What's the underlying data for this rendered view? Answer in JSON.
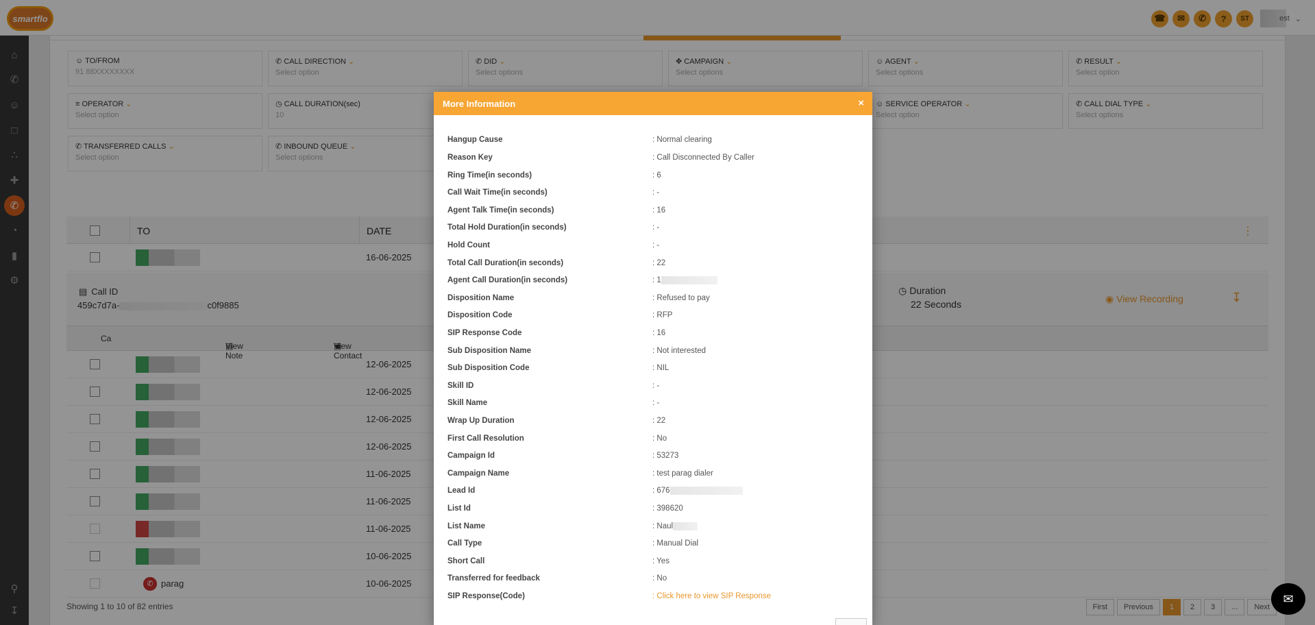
{
  "app": {
    "logo_text": "smartflo"
  },
  "topbar": {
    "icons": [
      "phone-icon",
      "chat-icon",
      "call-icon",
      "help-icon"
    ],
    "avatar_initials": "ST",
    "user_suffix": "est"
  },
  "sidebar": {
    "items": [
      "home-icon",
      "phone-icon",
      "users-icon",
      "monitor-icon",
      "network-icon",
      "plug-icon",
      "call-log-icon",
      "pie-chart-icon",
      "bar-chart-icon",
      "settings-icon",
      "search-icon",
      "download-icon"
    ]
  },
  "filters": [
    {
      "label": "TO/FROM",
      "value": "91 88XXXXXXXX",
      "icon": "person-icon"
    },
    {
      "label": "CALL DIRECTION",
      "value": "Select option",
      "icon": "phone-icon"
    },
    {
      "label": "DID",
      "value": "Select options",
      "icon": "phone-icon"
    },
    {
      "label": "CAMPAIGN",
      "value": "Select options",
      "icon": "campaign-icon"
    },
    {
      "label": "AGENT",
      "value": "Select options",
      "icon": "agent-icon"
    },
    {
      "label": "RESULT",
      "value": "Select option",
      "icon": "result-icon"
    },
    {
      "label": "OPERATOR",
      "value": "Select option",
      "icon": "operator-icon"
    },
    {
      "label": "CALL DURATION(sec)",
      "value": "10",
      "icon": "clock-icon"
    },
    {
      "label": "SERVICE OPERATOR",
      "value": "Select option",
      "icon": "service-icon"
    },
    {
      "label": "CALL DIAL TYPE",
      "value": "Select options",
      "icon": "phone-icon"
    },
    {
      "label": "TRANSFERRED CALLS",
      "value": "Select option",
      "icon": "phone-icon"
    },
    {
      "label": "INBOUND QUEUE",
      "value": "Select options",
      "icon": "phone-icon"
    }
  ],
  "table": {
    "headers": {
      "to": "TO",
      "date": "DATE"
    },
    "first_row_date": "16-06-2025",
    "detail": {
      "callid_label": "Call ID",
      "callid_prefix": "459c7d7a-",
      "callid_suffix": "c0f9885",
      "duration_label": "Duration",
      "duration_value": "22 Seconds",
      "view_recording": "View Recording"
    },
    "subbar": {
      "ca": "Ca",
      "view_note": "View Note",
      "view_contact": "View Contact"
    },
    "rows": [
      "12-06-2025",
      "12-06-2025",
      "12-06-2025",
      "12-06-2025",
      "11-06-2025",
      "11-06-2025",
      "11-06-2025",
      "10-06-2025",
      "10-06-2025"
    ],
    "last_row_name": "parag"
  },
  "footer": {
    "showing": "Showing 1 to 10 of 82 entries",
    "pager": [
      "First",
      "Previous",
      "1",
      "2",
      "3",
      "...",
      "Next"
    ]
  },
  "modal": {
    "title": "More Information",
    "close": "×",
    "fields": [
      {
        "key": "Hangup Cause",
        "value": ": Normal clearing"
      },
      {
        "key": "Reason Key",
        "value": ": Call Disconnected By Caller"
      },
      {
        "key": "Ring Time(in seconds)",
        "value": ": 6"
      },
      {
        "key": "Call Wait Time(in seconds)",
        "value": ": -"
      },
      {
        "key": "Agent Talk Time(in seconds)",
        "value": ": 16"
      },
      {
        "key": "Total Hold Duration(in seconds)",
        "value": ": -"
      },
      {
        "key": "Hold Count",
        "value": ": -"
      },
      {
        "key": "Total Call Duration(in seconds)",
        "value": ": 22"
      },
      {
        "key": "Agent Call Duration(in seconds)",
        "value": ": 1"
      },
      {
        "key": "Disposition Name",
        "value": ": Refused to pay"
      },
      {
        "key": "Disposition Code",
        "value": ": RFP"
      },
      {
        "key": "SIP Response Code",
        "value": ": 16"
      },
      {
        "key": "Sub Disposition Name",
        "value": ": Not interested"
      },
      {
        "key": "Sub Disposition Code",
        "value": ": NIL"
      },
      {
        "key": "Skill ID",
        "value": ": -"
      },
      {
        "key": "Skill Name",
        "value": ": -"
      },
      {
        "key": "Wrap Up Duration",
        "value": ": 22"
      },
      {
        "key": "First Call Resolution",
        "value": ": No"
      },
      {
        "key": "Campaign Id",
        "value": ": 53273"
      },
      {
        "key": "Campaign Name",
        "value": ": test parag dialer"
      },
      {
        "key": "Lead Id",
        "value": ": 676"
      },
      {
        "key": "List Id",
        "value": ": 398620"
      },
      {
        "key": "List Name",
        "value": ": Naul"
      },
      {
        "key": "Call Type",
        "value": ": Manual Dial"
      },
      {
        "key": "Short Call",
        "value": ": Yes"
      },
      {
        "key": "Transferred for feedback",
        "value": ": No"
      },
      {
        "key": "SIP Response(Code)",
        "value": ": Click here to view SIP Response"
      }
    ]
  },
  "colors": {
    "accent": "#f7a533",
    "sidebar": "#363636",
    "active": "#d65f1e"
  }
}
